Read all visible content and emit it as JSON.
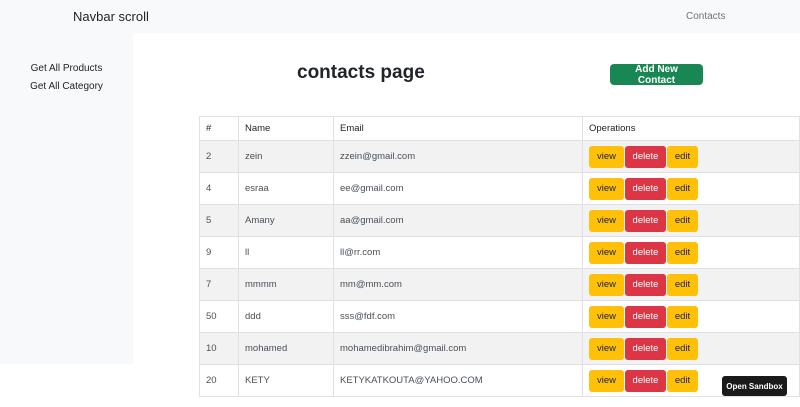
{
  "navbar": {
    "brand": "Navbar scroll",
    "link": "Contacts"
  },
  "sidebar": {
    "items": [
      {
        "label": "Get All Products"
      },
      {
        "label": "Get All Category"
      }
    ]
  },
  "main": {
    "title": "contacts page",
    "add_button": "Add New Contact"
  },
  "table": {
    "headers": [
      "#",
      "Name",
      "Email",
      "Operations"
    ],
    "operations": {
      "view": "view",
      "delete": "delete",
      "edit": "edit"
    },
    "rows": [
      {
        "id": "2",
        "name": "zein",
        "email": "zzein@gmail.com"
      },
      {
        "id": "4",
        "name": "esraa",
        "email": "ee@gmail.com"
      },
      {
        "id": "5",
        "name": "Amany",
        "email": "aa@gmail.com"
      },
      {
        "id": "9",
        "name": "ll",
        "email": "ll@rr.com"
      },
      {
        "id": "7",
        "name": "mmmm",
        "email": "mm@mm.com"
      },
      {
        "id": "50",
        "name": "ddd",
        "email": "sss@fdf.com"
      },
      {
        "id": "10",
        "name": "mohamed",
        "email": "mohamedibrahim@gmail.com"
      },
      {
        "id": "20",
        "name": "KETY",
        "email": "KETYKATKOUTA@YAHOO.COM"
      }
    ]
  },
  "sandbox_button": "Open Sandbox",
  "colors": {
    "success": "#198754",
    "warning": "#ffc107",
    "danger": "#dc3545",
    "light": "#f8f9fa"
  }
}
